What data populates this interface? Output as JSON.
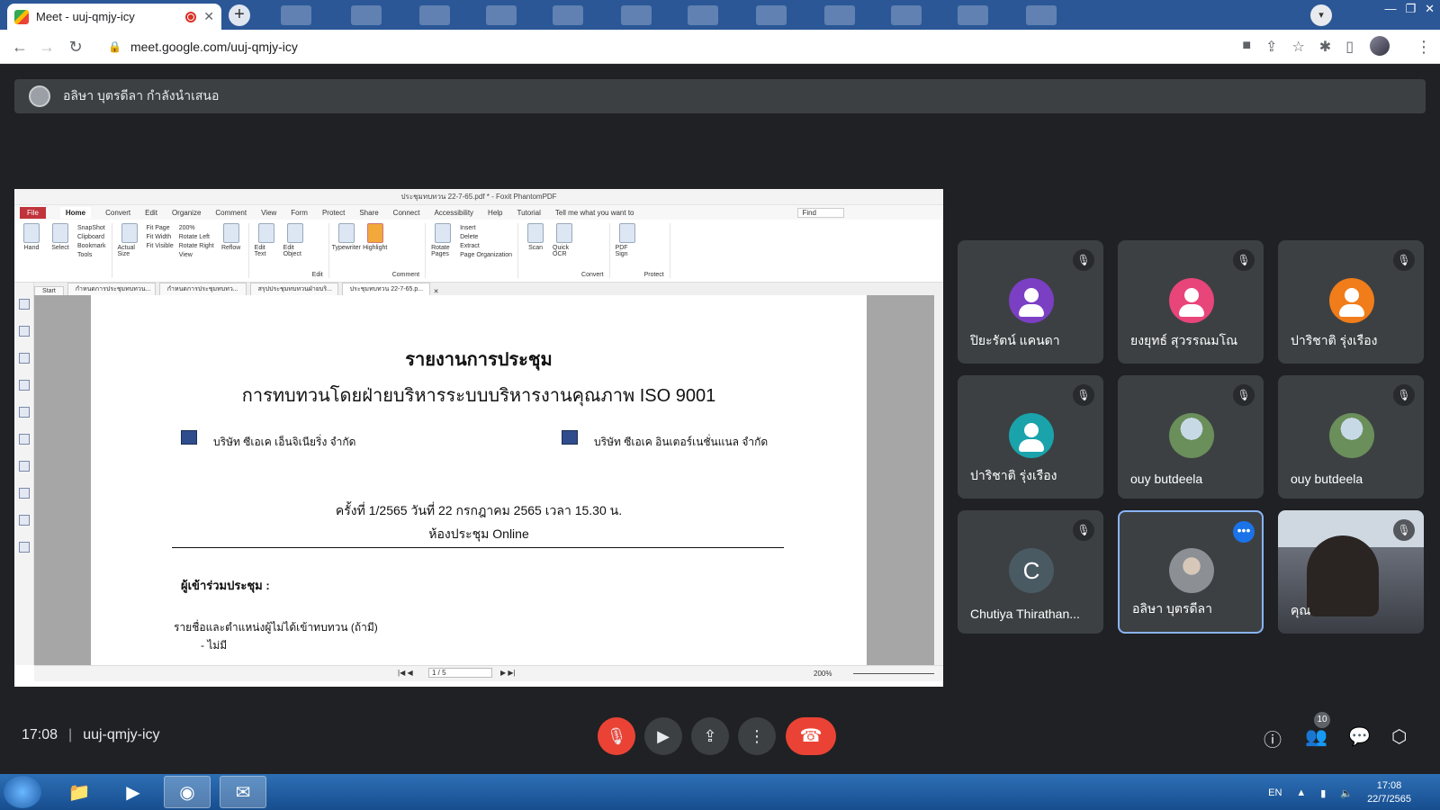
{
  "browser": {
    "tab_title": "Meet - uuj-qmjy-icy",
    "tab_close": "✕",
    "new_tab": "+",
    "url": "meet.google.com/uuj-qmjy-icy"
  },
  "presenter": {
    "text": "อลิษา บุตรดีลา กำลังนำเสนอ"
  },
  "shared_screen": {
    "window_title": "ประชุมทบทวน 22-7-65.pdf * - Foxit PhantomPDF",
    "menu": [
      "File",
      "Home",
      "Convert",
      "Edit",
      "Organize",
      "Comment",
      "View",
      "Form",
      "Protect",
      "Share",
      "Connect",
      "Accessibility",
      "Help",
      "Tutorial",
      "Tell me what you want to"
    ],
    "search_placeholder": "Find",
    "ribbon": {
      "hand": "Hand",
      "select": "Select",
      "snapshot": "SnapShot",
      "clipboard": "Clipboard",
      "bookmark": "Bookmark",
      "tools_group": "Tools",
      "actual_size": "Actual Size",
      "fit_page": "Fit Page",
      "fit_width": "Fit Width",
      "fit_visible": "Fit Visible",
      "zoom": "200%",
      "rotate_left": "Rotate Left",
      "rotate_right": "Rotate Right",
      "reflow": "Reflow",
      "view_group": "View",
      "edit_text": "Edit Text",
      "edit_object": "Edit Object",
      "edit_group": "Edit",
      "typewriter": "Typewriter",
      "highlight": "Highlight",
      "comment_group": "Comment",
      "rotate_pages": "Rotate Pages",
      "insert": "Insert",
      "delete": "Delete",
      "extract": "Extract",
      "page_org_group": "Page Organization",
      "scan": "Scan",
      "quick_ocr": "Quick OCR",
      "convert_group": "Convert",
      "pdf_sign": "PDF Sign",
      "protect_group": "Protect"
    },
    "doc_tabs": [
      "Start",
      "กำหนดการประชุมทบทวน...",
      "กำหนดการประชุมทบทว...",
      "สรุปประชุมทบทวนฝ่ายบริ...",
      "ประชุมทบทวน 22-7-65.p..."
    ],
    "doc_tab_close": "✕",
    "status_page": "1 / 5",
    "status_zoom": "200%",
    "page": {
      "title1": "รายงานการประชุม",
      "title2": "การทบทวนโดยฝ่ายบริหารระบบบริหารงานคุณภาพ ISO 9001",
      "company1": "บริษัท ซีเอเค เอ็นจิเนียริ่ง จำกัด",
      "company2": "บริษัท ซีเอเค อินเตอร์เนชั่นแนล จำกัด",
      "meeting_no": "ครั้งที่ 1/2565 วันที่ 22 กรกฎาคม 2565 เวลา 15.30 น.",
      "room": "ห้องประชุม Online",
      "attendees": "ผู้เข้าร่วมประชุม :",
      "absent": "รายชื่อและตำแหน่งผู้ไม่ได้เข้าทบทวน (ถ้ามี)",
      "none": "- ไม่มี"
    }
  },
  "participants": [
    {
      "name": "ปิยะรัตน์ แคนดา",
      "avatar": "person",
      "color": "#7b3fc4"
    },
    {
      "name": "ยงยุทธ์ สุวรรณมโณ",
      "avatar": "person",
      "color": "#e8457a"
    },
    {
      "name": "ปาริชาติ รุ่งเรือง",
      "avatar": "person",
      "color": "#f07d1a"
    },
    {
      "name": "ปาริชาติ รุ่งเรือง",
      "avatar": "person",
      "color": "#1aa3ab"
    },
    {
      "name": "ouy butdeela",
      "avatar": "photo",
      "color": "#6a8f5a"
    },
    {
      "name": "ouy butdeela",
      "avatar": "photo",
      "color": "#6a8f5a"
    },
    {
      "name": "Chutiya Thirathan...",
      "avatar": "letter",
      "letter": "C",
      "color": "#4a5a63"
    },
    {
      "name": "อลิษา บุตรดีลา",
      "avatar": "photo",
      "color": "#8c9095"
    },
    {
      "name": "คุณ",
      "avatar": "video",
      "color": "#333333"
    }
  ],
  "meeting": {
    "time": "17:08",
    "separator": "|",
    "code": "uuj-qmjy-icy",
    "people_count": "10"
  },
  "taskbar": {
    "lang": "EN",
    "time": "17:08",
    "date": "22/7/2565"
  },
  "colors": {
    "meet_bg": "#202124",
    "tile_bg": "#3c4043",
    "mic_off_red": "#ea4335",
    "selected_border": "#8ab4f8"
  }
}
